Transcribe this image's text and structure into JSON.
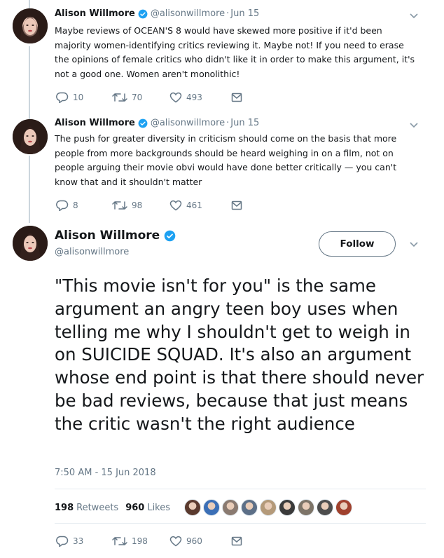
{
  "tweets": [
    {
      "name": "Alison Willmore",
      "handle": "@alisonwillmore",
      "dot": "·",
      "date": "Jun 15",
      "text": "Maybe reviews of OCEAN'S 8 would have skewed more positive if it'd been majority women-identifying critics reviewing it. Maybe not! If you need to erase the opinions of female critics who didn't like it in order to make this argument, it's not a good one. Women aren't monolithic!",
      "replies": "10",
      "retweets": "70",
      "likes": "493"
    },
    {
      "name": "Alison Willmore",
      "handle": "@alisonwillmore",
      "dot": "·",
      "date": "Jun 15",
      "text": "The push for greater diversity in criticism should come on the basis that more people from more backgrounds should be heard weighing in on a film, not on people arguing their movie obvi would have done better critically — you can't know that and it shouldn't matter",
      "replies": "8",
      "retweets": "98",
      "likes": "461"
    }
  ],
  "main": {
    "name": "Alison Willmore",
    "handle": "@alisonwillmore",
    "follow_label": "Follow",
    "text": "\"This movie isn't for you\" is the same argument an angry teen boy uses when telling me why I shouldn't get to weigh in on SUICIDE SQUAD. It's also an argument whose end point is that there should never be bad reviews, because that just means the critic wasn't the right audience",
    "timestamp": "7:50 AM - 15 Jun 2018",
    "retweet_count": "198",
    "retweet_label": "Retweets",
    "like_count": "960",
    "like_label": "Likes",
    "replies": "33",
    "retweets": "198",
    "likes": "960"
  },
  "colors": {
    "verified": "#1da1f2",
    "secondary_text": "#657786",
    "thread_line": "#ccd6dd"
  },
  "liker_avatar_colors": [
    "#5a3a2e",
    "#3b6fb6",
    "#8a7a70",
    "#5c6f87",
    "#b49a7a",
    "#3a3a3a",
    "#7d7468",
    "#4d4d4d",
    "#a0412d"
  ]
}
